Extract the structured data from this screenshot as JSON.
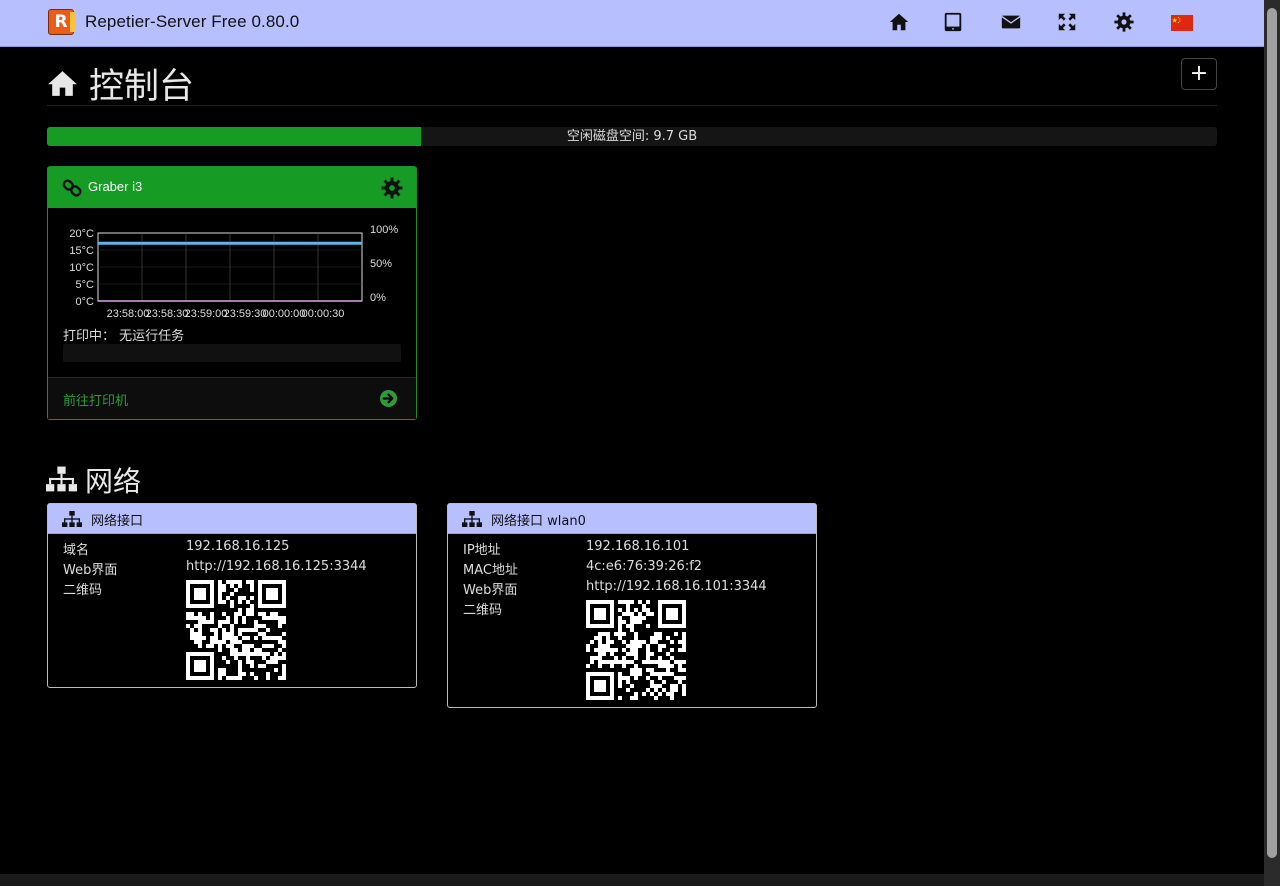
{
  "app": {
    "title": "Repetier-Server Free 0.80.0",
    "logo_letter": "R"
  },
  "navbar": {
    "icons": [
      "home-icon",
      "tablet-icon",
      "envelope-icon",
      "fullscreen-icon",
      "gear-icon",
      "flag-china-icon"
    ]
  },
  "page": {
    "title": "控制台",
    "add_label": "+"
  },
  "disk": {
    "label": "空闲磁盘空间: 9.7 GB",
    "used_fraction": 0.32,
    "fill_color": "#169b25"
  },
  "printer": {
    "name": "Graber i3",
    "status_label": "打印中：",
    "status_value": "无运行任务",
    "goto_label": "前往打印机",
    "header_color": "#169b25"
  },
  "chart_data": {
    "type": "line",
    "y_left_ticks": [
      "20°C",
      "15°C",
      "10°C",
      "5°C",
      "0°C"
    ],
    "y_right_ticks": [
      "100%",
      "50%",
      "0%"
    ],
    "x_tick_labels": [
      "23:58:00",
      "23:58:30",
      "23:59:00",
      "23:59:30",
      "00:00:00",
      "00:00:30"
    ],
    "ylim": [
      0,
      20
    ],
    "series": [
      {
        "color": "#5fb4e8",
        "values": [
          17,
          17,
          17,
          17,
          17,
          17,
          17
        ]
      },
      {
        "color": "#d7a8e6",
        "values": [
          0,
          0,
          0,
          0,
          0,
          0,
          0
        ]
      }
    ],
    "grid": true
  },
  "network": {
    "title": "网络",
    "interfaces": [
      {
        "title": "网络接口",
        "rows": [
          {
            "key": "域名",
            "value": "192.168.16.125"
          },
          {
            "key": "Web界面",
            "value": "http://192.168.16.125:3344"
          },
          {
            "key": "二维码",
            "value": ""
          }
        ]
      },
      {
        "title": "网络接口 wlan0",
        "rows": [
          {
            "key": "IP地址",
            "value": "192.168.16.101"
          },
          {
            "key": "MAC地址",
            "value": "4c:e6:76:39:26:f2"
          },
          {
            "key": "Web界面",
            "value": "http://192.168.16.101:3344"
          },
          {
            "key": "二维码",
            "value": ""
          }
        ]
      }
    ]
  }
}
